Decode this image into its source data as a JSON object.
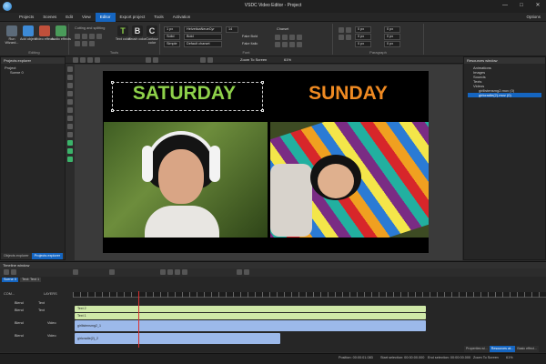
{
  "window": {
    "title": "VSDC Video Editor - Project"
  },
  "menu": [
    "Projects",
    "Scenes",
    "Edit",
    "View",
    "Editor",
    "Export project",
    "Tools",
    "Activation"
  ],
  "menu_active": "Editor",
  "options_label": "Options",
  "ribbon": {
    "editing": {
      "label": "Editing",
      "buttons": [
        "Run Wizard...",
        "Add object",
        "Video effects",
        "Audio effects"
      ]
    },
    "tools": {
      "label": "Tools",
      "cutting": "Cutting and splitting",
      "buttons": [
        "Text color",
        "Brush color",
        "Contour color"
      ]
    },
    "font": {
      "label": "Font",
      "font_name": "HelveticaNeueCyr",
      "font_weight": "Bold",
      "charset": "Default charset",
      "size": "14",
      "width": "1 px",
      "style": "Solid",
      "simple": "Simple",
      "fake_bold": "Fake Bold",
      "fake_italic": "Fake Italic",
      "charset_label": "Charset"
    },
    "paragraph": {
      "label": "Paragraph",
      "values": [
        "0 px",
        "0 px",
        "0 px",
        "0 px",
        "0 px",
        "0 px"
      ]
    }
  },
  "toolbar2": {
    "zoom_label": "Zoom To Screen",
    "zoom_pct": "61%"
  },
  "projects_explorer": {
    "title": "Projects explorer",
    "tree": [
      "Project",
      "Scene 0"
    ],
    "tabs": [
      "Objects explorer",
      "Projects explorer"
    ],
    "active_tab": "Projects explorer"
  },
  "canvas": {
    "left_text": "SATURDAY",
    "right_text": "SUNDAY",
    "left_color": "#8ed14a",
    "right_color": "#ef8a22"
  },
  "resources": {
    "title": "Resources window",
    "tree": [
      "Animations",
      "Images",
      "Sounds",
      "Texts",
      "Videos",
      "girllistensmg2.mov (0)",
      "girlcradle(2).mov (0)"
    ]
  },
  "timeline": {
    "title": "Timeline window",
    "scene_tabs": [
      "Scene 0",
      "Text: Text 1"
    ],
    "layers_label": "LAYERS",
    "com_label": "COM...",
    "tracks": [
      {
        "blend": "Blend",
        "type": "Text",
        "clip": "Text 2",
        "color": "#cfe8a8"
      },
      {
        "blend": "Blend",
        "type": "Text",
        "clip": "Text 1",
        "color": "#cfe8a8"
      },
      {
        "blend": "Blend",
        "type": "Video",
        "clip": "girllistensmg2_1",
        "color": "#9cb9ea"
      },
      {
        "blend": "Blend",
        "type": "Video",
        "clip": "girlcradle(2)_2",
        "color": "#9cb9ea"
      }
    ]
  },
  "bottom_tabs": [
    "Properties wi...",
    "Resources wi...",
    "Basic effect..."
  ],
  "bottom_active": "Resources wi...",
  "status": {
    "position": "Position:   00:00:01.083",
    "start": "Start selection:   00:00:00.000",
    "end": "End selection:   00:00:00.000",
    "zoom": "Zoom To Screen",
    "pct": "61%"
  }
}
